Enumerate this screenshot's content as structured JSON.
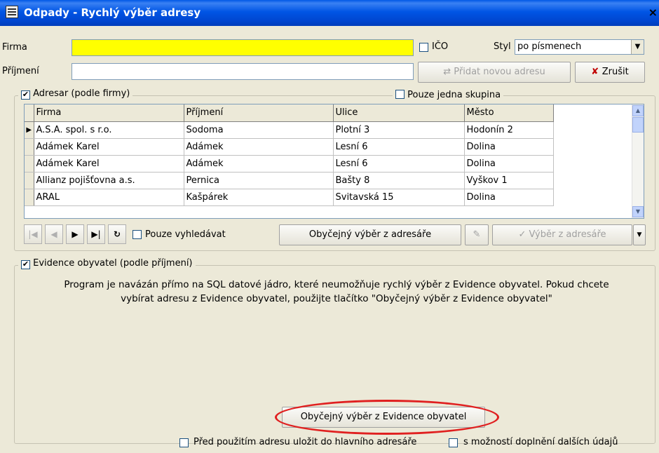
{
  "window": {
    "title": "Odpady - Rychlý výběr adresy",
    "icon": "app-window-icon",
    "close": "×"
  },
  "top": {
    "firma_label": "Firma",
    "firma_value": "",
    "prijmeni_label": "Příjmení",
    "prijmeni_value": "",
    "ico_label": "IČO",
    "styl_label": "Styl",
    "styl_value": "po písmenech",
    "pridat_button": "Přidat novou adresu",
    "zrusit_button": "Zrušit"
  },
  "adresar": {
    "group_label": "Adresar (podle firmy)",
    "pouze_skupina_label": "Pouze jedna skupina",
    "columns": [
      "Firma",
      "Příjmení",
      "Ulice",
      "Město"
    ],
    "rows": [
      [
        "A.S.A. spol. s r.o.",
        "Sodoma",
        "Plotní 3",
        "Hodonín 2"
      ],
      [
        "Adámek Karel",
        "Adámek",
        "Lesní 6",
        "Dolina"
      ],
      [
        "Adámek Karel",
        "Adámek",
        "Lesní 6",
        "Dolina"
      ],
      [
        "Allianz pojišťovna a.s.",
        "Pernica",
        "Bašty 8",
        "Vyškov 1"
      ],
      [
        "ARAL",
        "Kašpárek",
        "Svitavská 15",
        "Dolina"
      ]
    ],
    "nav": {
      "first": "|◀",
      "prev": "◀",
      "next": "▶",
      "last": "▶|",
      "refresh": "↻"
    },
    "pouze_vyhledavat_label": "Pouze vyhledávat",
    "obycejny_vyber_button": "Obyčejný výběr z adresáře",
    "vyber_button": "Výběr z adresáře"
  },
  "evidence": {
    "group_label": "Evidence obyvatel (podle příjmení)",
    "info_line1": "Program je navázán přímo na SQL datové jádro, které neumožňuje rychlý výběr z Evidence obyvatel. Pokud chcete",
    "info_line2": "vybírat adresu z Evidence obyvatel, použijte tlačítko \"Obyčejný výběr z Evidence obyvatel\"",
    "obycejny_button": "Obyčejný výběr z Evidence obyvatel"
  },
  "bottom": {
    "ulozit_label": "Před použitím adresu uložit do hlavního adresáře",
    "doplneni_label": "s možností doplnění dalších údajů"
  },
  "colors": {
    "accent_yellow": "#ffff00",
    "titlebar_blue": "#0055e5",
    "highlight_red": "#e02020"
  }
}
